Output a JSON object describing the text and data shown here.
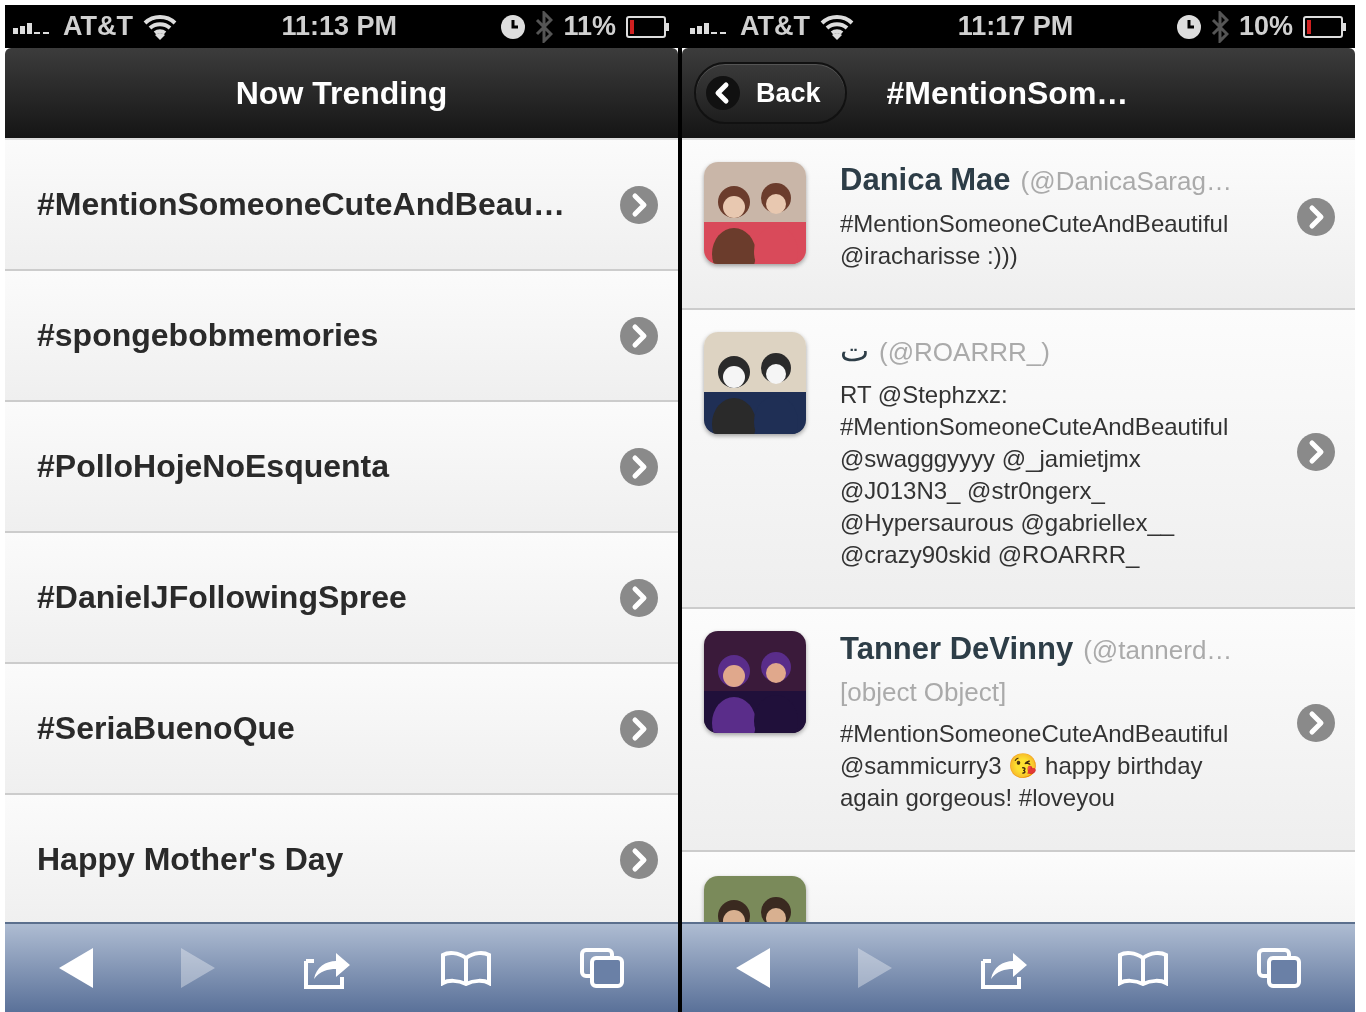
{
  "screens": [
    {
      "status_bar": {
        "carrier": "AT&T",
        "time": "11:13 PM",
        "battery": "11%"
      },
      "nav_bar": {
        "title": "Now Trending"
      },
      "trends": [
        {
          "label": "#MentionSomeoneCuteAndBeau…"
        },
        {
          "label": "#spongebobmemories"
        },
        {
          "label": "#PolloHojeNoEsquenta"
        },
        {
          "label": "#DanielJFollowingSpree"
        },
        {
          "label": "#SeriaBuenoQue"
        },
        {
          "label": "Happy Mother's Day"
        }
      ],
      "toolbar": [
        {
          "kind": "back",
          "disabled": false
        },
        {
          "kind": "forward",
          "disabled": true
        },
        {
          "kind": "share",
          "disabled": false
        },
        {
          "kind": "bookmarks",
          "disabled": false
        },
        {
          "kind": "pages",
          "disabled": false
        }
      ]
    },
    {
      "status_bar": {
        "carrier": "AT&T",
        "time": "11:17 PM",
        "battery": "10%"
      },
      "nav_bar": {
        "back_button": "Back",
        "title": "#MentionSom…"
      },
      "tweets": [
        {
          "name": "Danica Mae",
          "bold_name": true,
          "handle": "(@DanicaSarag…",
          "text": "#MentionSomeoneCuteAndBeautiful\n@iracharisse :)))"
        },
        {
          "name": "ت",
          "bold_name": false,
          "handle": "(@ROARRR_)",
          "text": "RT @Stephzxz:\n#MentionSomeoneCuteAndBeautiful\n@swagggyyyy @_jamietjmx\n@J013N3_ @str0ngerx_\n@Hypersaurous @gabriellex__\n@crazy90skid @ROARRR_"
        },
        {
          "name": "Tanner DeVinny",
          "bold_name": true,
          "handle": "(@tannerd…",
          "note": "[object Object]",
          "text": "#MentionSomeoneCuteAndBeautiful\n@sammicurry3 😘 happy birthday\nagain gorgeous! #loveyou"
        }
      ],
      "toolbar": [
        {
          "kind": "back",
          "disabled": false
        },
        {
          "kind": "forward",
          "disabled": true
        },
        {
          "kind": "share",
          "disabled": false
        },
        {
          "kind": "bookmarks",
          "disabled": false
        },
        {
          "kind": "pages",
          "disabled": false
        }
      ]
    }
  ]
}
